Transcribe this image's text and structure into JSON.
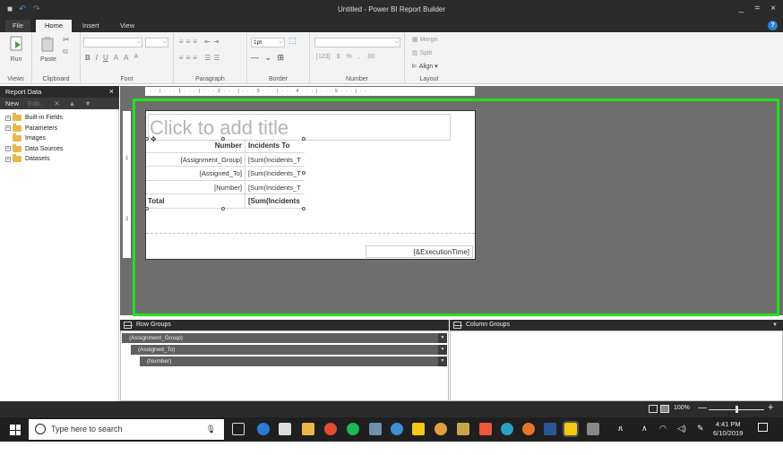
{
  "window": {
    "title": "Untitled - Power BI Report Builder",
    "min": "_",
    "max": "=",
    "close": "×",
    "qa_save": "■",
    "qa_undo": "↶",
    "qa_redo": "↷"
  },
  "ribbon_tabs": [
    {
      "label": "File"
    },
    {
      "label": "Home"
    },
    {
      "label": "Insert"
    },
    {
      "label": "View"
    }
  ],
  "help": "?",
  "ribbon": {
    "views": {
      "run_label": "Run",
      "group": "Views"
    },
    "clipboard": {
      "paste_label": "Paste",
      "group": "Clipboard"
    },
    "font": {
      "group": "Font",
      "bold": "B",
      "italic": "I",
      "underline": "U"
    },
    "paragraph": {
      "group": "Paragraph"
    },
    "border": {
      "group": "Border",
      "width_value": "1pt"
    },
    "number": {
      "group": "Number",
      "currency": "$",
      "percent": "%"
    },
    "layout": {
      "group": "Layout",
      "merge": "Merge",
      "split": "Split",
      "align": "Align"
    }
  },
  "report_data": {
    "title": "Report Data",
    "close": "×",
    "toolbar": {
      "new": "New",
      "edit": "Edit..."
    },
    "items": [
      {
        "label": "Built-in Fields",
        "expandable": true
      },
      {
        "label": "Parameters",
        "expandable": true
      },
      {
        "label": "Images",
        "expandable": false
      },
      {
        "label": "Data Sources",
        "expandable": true
      },
      {
        "label": "Datasets",
        "expandable": true
      }
    ]
  },
  "report": {
    "title_placeholder": "Click to add title",
    "tablix": {
      "headers": [
        "Number",
        "Incidents To"
      ],
      "rows": [
        [
          "[Assignment_Group]",
          "[Sum(Incidents_T"
        ],
        [
          "[Assigned_To]",
          "[Sum(Incidents_T"
        ],
        [
          "[Number]",
          "[Sum(Incidents_T"
        ]
      ],
      "total": [
        "Total",
        "[Sum(Incidents"
      ]
    },
    "footer_expression": "[&ExecutionTime]"
  },
  "ruler": {
    "top": "· · · | · · · 1 · · · | · · · 2 · · · | · · · 3 · · · | · · · 4 · · · | · · · 5 · · · | · · ·",
    "side": [
      "1",
      "2"
    ]
  },
  "row_groups": {
    "title": "Row Groups",
    "items": [
      "(Assignment_Group)",
      "(Assigned_To)",
      "(Number)"
    ]
  },
  "column_groups": {
    "title": "Column Groups"
  },
  "status": {
    "zoom": "100%",
    "zoom_minus": "—",
    "zoom_plus": "+"
  },
  "taskbar": {
    "search_placeholder": "Type here to search",
    "time": "4:41 PM",
    "date": "6/10/2019"
  },
  "colors": {
    "highlight": "#1ee01e",
    "canvas": "#6e6e6e",
    "chrome": "#2b2b2b",
    "accent": "#2f7fd1"
  }
}
